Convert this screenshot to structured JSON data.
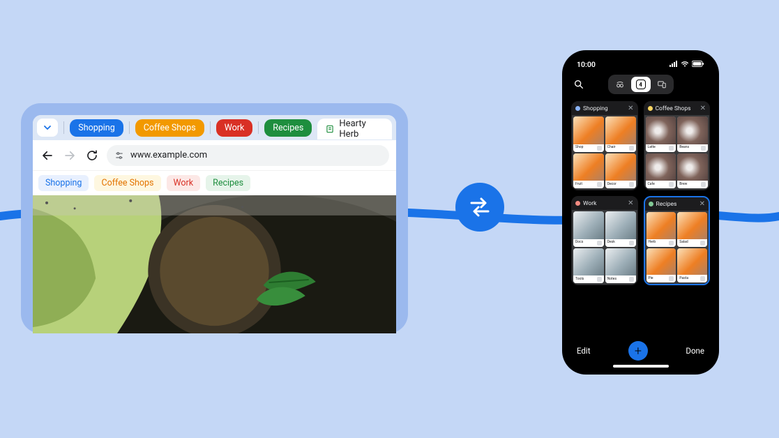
{
  "desktop": {
    "groups": [
      {
        "label": "Shopping",
        "color": "blue"
      },
      {
        "label": "Coffee Shops",
        "color": "orange"
      },
      {
        "label": "Work",
        "color": "red"
      },
      {
        "label": "Recipes",
        "color": "green"
      }
    ],
    "active_tab_label": "Hearty Herb",
    "address": "www.example.com",
    "bookmarks": [
      {
        "label": "Shopping",
        "variant": "blue"
      },
      {
        "label": "Coffee Shops",
        "variant": "orange"
      },
      {
        "label": "Work",
        "variant": "red"
      },
      {
        "label": "Recipes",
        "variant": "green"
      }
    ]
  },
  "phone": {
    "time": "10:00",
    "tab_count": "4",
    "groups": [
      {
        "title": "Shopping",
        "dot": "blue",
        "selected": false,
        "thumb_variant": "food"
      },
      {
        "title": "Coffee Shops",
        "dot": "yellow",
        "selected": false,
        "thumb_variant": "coffee"
      },
      {
        "title": "Work",
        "dot": "red",
        "selected": false,
        "thumb_variant": "work"
      },
      {
        "title": "Recipes",
        "dot": "green",
        "selected": true,
        "thumb_variant": "food"
      }
    ],
    "edit_label": "Edit",
    "done_label": "Done"
  }
}
